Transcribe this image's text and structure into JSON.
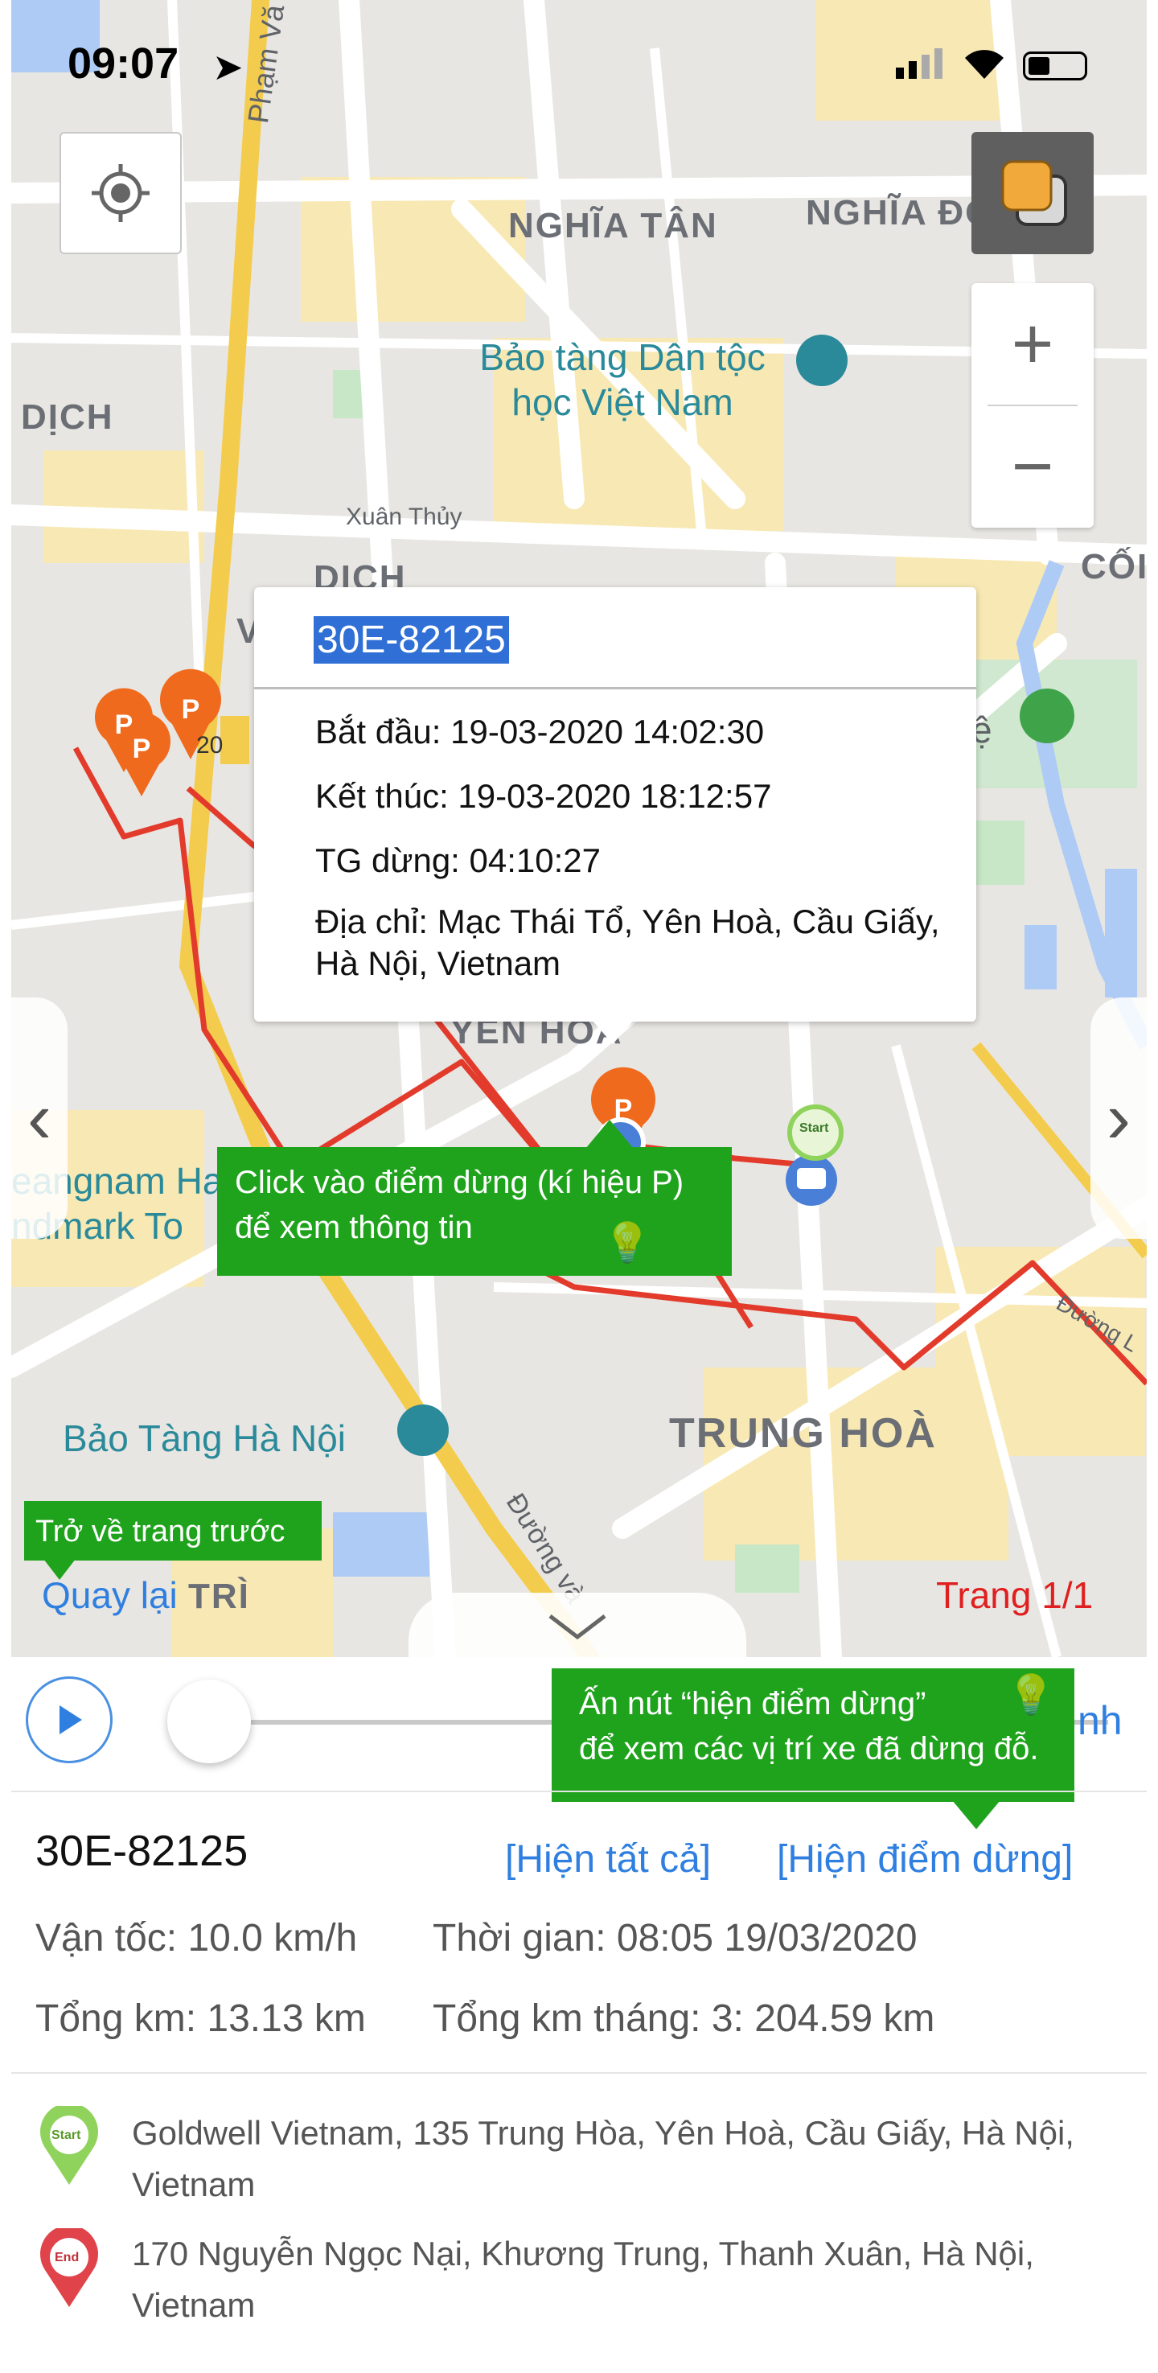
{
  "status_bar": {
    "time": "09:07"
  },
  "map": {
    "labels": {
      "pham_van": "Phạm Vă",
      "nghia_tan": "NGHĨA TÂN",
      "nghia_do": "NGHĨA ĐÔ",
      "dich": "DỊCH",
      "museum_line1": "Bảo tàng Dân tộc",
      "museum_line2": "học Việt Nam",
      "xuan_thuy": "Xuân Thủy",
      "dich_vong": "DỊCH",
      "v": "V",
      "coi": "CỐI",
      "yen_hoa": "YÊN HÒA",
      "keangnam_line1": "eangnam Hanoi",
      "keangnam_line2": "ndmark To",
      "trung_hoa": "TRUNG HOÀ",
      "bao_tang_ha_noi": "Bảo Tàng Hà Nội",
      "duong_va": "Đường và",
      "tri": "TRÌ",
      "duong_l": "Đường L",
      "road_20": "20",
      "e": "ệ"
    },
    "start_marker": "Start",
    "parking_symbol": "P",
    "zoom_in": "+",
    "zoom_out": "−",
    "prev_arrow": "‹",
    "next_arrow": "›",
    "collapse_arrow": "⌄"
  },
  "popup": {
    "title": "30E-82125",
    "start": "Bắt đầu: 19-03-2020 14:02:30",
    "end": "Kết thúc: 19-03-2020 18:12:57",
    "stop_duration": "TG dừng: 04:10:27",
    "address": "Địa chỉ: Mạc Thái Tổ, Yên Hoà, Cầu Giấy, Hà Nội, Vietnam"
  },
  "tips": {
    "click_stop_line1": "Click vào điểm dừng (kí hiệu P)",
    "click_stop_line2": "để xem thông tin",
    "back_hint": "Trở về trang trước",
    "show_stop_line1": "Ấn nút “hiện điểm dừng”",
    "show_stop_line2": "để xem các vị trí xe đã dừng đỗ."
  },
  "nav": {
    "back": "Quay lại",
    "page": "Trang 1/1",
    "hidden_right": "nh"
  },
  "player": {
    "progress": 0.0
  },
  "vehicle": {
    "plate": "30E-82125",
    "show_all": "[Hiện tất cả]",
    "show_stops": "[Hiện điểm dừng]",
    "speed": "Vận tốc: 10.0 km/h",
    "time": "Thời gian: 08:05 19/03/2020",
    "total_km": "Tổng km: 13.13 km",
    "month_km": "Tổng km tháng: 3: 204.59 km"
  },
  "route": {
    "start_label": "Start",
    "end_label": "End",
    "start_address": "Goldwell Vietnam, 135 Trung Hòa, Yên Hoà, Cầu Giấy, Hà Nội, Vietnam",
    "end_address": "170 Nguyễn Ngọc Nại, Khương Trung, Thanh Xuân, Hà Nội, Vietnam"
  },
  "colors": {
    "route": "#e23b2c",
    "parking": "#f06a1e",
    "tip_green": "#1fa31c",
    "link_blue": "#2f7fe0",
    "page_red": "#e02020",
    "start_green": "#8fd35c",
    "end_red": "#e0434a"
  }
}
